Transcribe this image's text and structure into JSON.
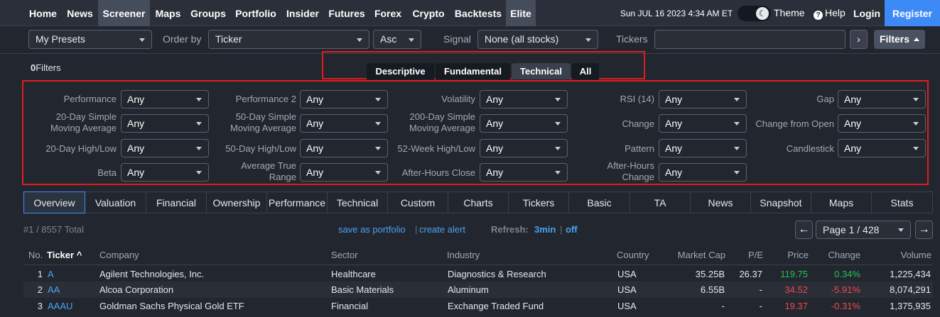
{
  "nav": {
    "items": [
      {
        "label": "Home"
      },
      {
        "label": "News"
      },
      {
        "label": "Screener"
      },
      {
        "label": "Maps"
      },
      {
        "label": "Groups"
      },
      {
        "label": "Portfolio"
      },
      {
        "label": "Insider"
      },
      {
        "label": "Futures"
      },
      {
        "label": "Forex"
      },
      {
        "label": "Crypto"
      },
      {
        "label": "Backtests"
      },
      {
        "label": "Elite"
      }
    ],
    "datetime": "Sun JUL 16 2023 4:34 AM ET",
    "theme_label": "Theme",
    "theme_icon": "☾",
    "help_label": "Help",
    "help_icon": "?",
    "login_label": "Login",
    "register_label": "Register"
  },
  "controls": {
    "presets_value": "My Presets",
    "order_by_label": "Order by",
    "order_by_value": "Ticker",
    "direction_value": "Asc",
    "signal_label": "Signal",
    "signal_value": "None (all stocks)",
    "tickers_label": "Tickers",
    "tickers_go": "›",
    "filters_button": "Filters"
  },
  "filter_count": {
    "number": "0",
    "label": "Filters"
  },
  "filter_tabs": [
    {
      "label": "Descriptive"
    },
    {
      "label": "Fundamental"
    },
    {
      "label": "Technical"
    },
    {
      "label": "All"
    }
  ],
  "filters": [
    {
      "label": "Performance",
      "value": "Any"
    },
    {
      "label": "Performance 2",
      "value": "Any"
    },
    {
      "label": "Volatility",
      "value": "Any"
    },
    {
      "label": "RSI (14)",
      "value": "Any"
    },
    {
      "label": "Gap",
      "value": "Any"
    },
    {
      "label1": "20-Day Simple",
      "label2": "Moving Average",
      "value": "Any"
    },
    {
      "label1": "50-Day Simple",
      "label2": "Moving Average",
      "value": "Any"
    },
    {
      "label1": "200-Day Simple",
      "label2": "Moving Average",
      "value": "Any"
    },
    {
      "label": "Change",
      "value": "Any"
    },
    {
      "label": "Change from Open",
      "value": "Any"
    },
    {
      "label": "20-Day High/Low",
      "value": "Any"
    },
    {
      "label": "50-Day High/Low",
      "value": "Any"
    },
    {
      "label": "52-Week High/Low",
      "value": "Any"
    },
    {
      "label": "Pattern",
      "value": "Any"
    },
    {
      "label": "Candlestick",
      "value": "Any"
    },
    {
      "label": "Beta",
      "value": "Any"
    },
    {
      "label1": "Average True",
      "label2": "Range",
      "value": "Any"
    },
    {
      "label": "After-Hours Close",
      "value": "Any"
    },
    {
      "label1": "After-Hours",
      "label2": "Change",
      "value": "Any"
    }
  ],
  "view_tabs": [
    {
      "label": "Overview"
    },
    {
      "label": "Valuation"
    },
    {
      "label": "Financial"
    },
    {
      "label": "Ownership"
    },
    {
      "label": "Performance"
    },
    {
      "label": "Technical"
    },
    {
      "label": "Custom"
    },
    {
      "label": "Charts"
    },
    {
      "label": "Tickers"
    },
    {
      "label": "Basic"
    },
    {
      "label": "TA"
    },
    {
      "label": "News"
    },
    {
      "label": "Snapshot"
    },
    {
      "label": "Maps"
    },
    {
      "label": "Stats"
    }
  ],
  "results": {
    "total": "#1 / 8557 Total",
    "save_portfolio": "save as portfolio",
    "separator": "|",
    "create_alert": "create alert",
    "refresh_label": "Refresh:",
    "refresh_interval": "3min",
    "refresh_off": "off",
    "prev_icon": "←",
    "next_icon": "→",
    "page_value": "Page 1 / 428"
  },
  "table": {
    "headers": [
      "No.",
      "Ticker",
      "Company",
      "Sector",
      "Industry",
      "Country",
      "Market Cap",
      "P/E",
      "Price",
      "Change",
      "Volume"
    ],
    "sort_indicator": "^",
    "rows": [
      {
        "no": "1",
        "ticker": "A",
        "company": "Agilent Technologies, Inc.",
        "sector": "Healthcare",
        "industry": "Diagnostics & Research",
        "country": "USA",
        "market_cap": "35.25B",
        "pe": "26.37",
        "price": "119.75",
        "change": "0.34%",
        "volume": "1,225,434"
      },
      {
        "no": "2",
        "ticker": "AA",
        "company": "Alcoa Corporation",
        "sector": "Basic Materials",
        "industry": "Aluminum",
        "country": "USA",
        "market_cap": "6.55B",
        "pe": "-",
        "price": "34.52",
        "change": "-5.91%",
        "volume": "8,074,291"
      },
      {
        "no": "3",
        "ticker": "AAAU",
        "company": "Goldman Sachs Physical Gold ETF",
        "sector": "Financial",
        "industry": "Exchange Traded Fund",
        "country": "USA",
        "market_cap": "-",
        "pe": "-",
        "price": "19.37",
        "change": "-0.31%",
        "volume": "1,375,935"
      }
    ],
    "up_color": "#27c04f",
    "down_color": "#ef4a4a"
  },
  "colors": {
    "accent": "#3d8af7",
    "highlight_box": "#e11d1d",
    "link": "#4aa3f0"
  }
}
